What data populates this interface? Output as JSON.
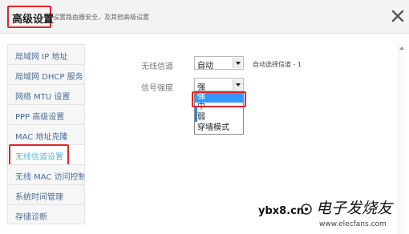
{
  "header": {
    "title": "高级设置",
    "subtitle": "设置路由器安全，及其他高级设置",
    "close_icon": "close-icon"
  },
  "sidebar": {
    "items": [
      {
        "label": "局域网 IP 地址",
        "active": false
      },
      {
        "label": "局域网 DHCP 服务",
        "active": false
      },
      {
        "label": "网络 MTU 设置",
        "active": false
      },
      {
        "label": "PPP 高级设置",
        "active": false
      },
      {
        "label": "MAC 地址克隆",
        "active": false
      },
      {
        "label": "无线信道设置",
        "active": true
      },
      {
        "label": "无线 MAC 访问控制",
        "active": false
      },
      {
        "label": "系统时间管理",
        "active": false
      },
      {
        "label": "存储诊断",
        "active": false
      }
    ]
  },
  "form": {
    "channel_label": "无线信道",
    "channel_value": "自动",
    "channel_hint": "自动选择信道 - 1",
    "strength_label": "信号强度",
    "strength_value": "强"
  },
  "dropdown": {
    "options": [
      "强",
      "中",
      "弱",
      "穿墙模式"
    ],
    "selected_index": 0
  },
  "watermark": {
    "url_text": "ybx8.cn",
    "brand_text": "电子发烧友",
    "site_text": "www.elecfans.com"
  },
  "colors": {
    "highlight_red": "#e0262f",
    "selected_blue": "#3399ff",
    "active_nav": "#58b3d8",
    "nav_text": "#4a6e93"
  }
}
